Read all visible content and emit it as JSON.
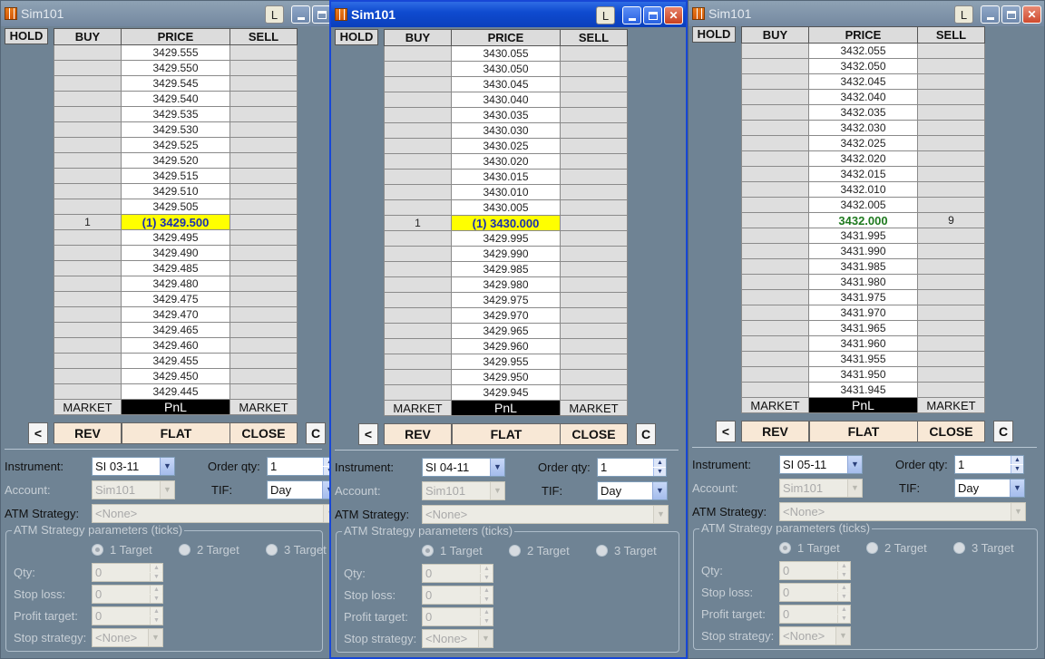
{
  "windows": [
    {
      "title": "Sim101",
      "active": false,
      "l_label": "L",
      "hold": "HOLD",
      "headers": [
        "BUY",
        "PRICE",
        "SELL"
      ],
      "rows": [
        {
          "buy": "",
          "price": "3429.555",
          "sell": ""
        },
        {
          "buy": "",
          "price": "3429.550",
          "sell": ""
        },
        {
          "buy": "",
          "price": "3429.545",
          "sell": ""
        },
        {
          "buy": "",
          "price": "3429.540",
          "sell": ""
        },
        {
          "buy": "",
          "price": "3429.535",
          "sell": ""
        },
        {
          "buy": "",
          "price": "3429.530",
          "sell": ""
        },
        {
          "buy": "",
          "price": "3429.525",
          "sell": ""
        },
        {
          "buy": "",
          "price": "3429.520",
          "sell": ""
        },
        {
          "buy": "",
          "price": "3429.515",
          "sell": ""
        },
        {
          "buy": "",
          "price": "3429.510",
          "sell": ""
        },
        {
          "buy": "",
          "price": "3429.505",
          "sell": ""
        },
        {
          "buy": "1",
          "price": "(1) 3429.500",
          "sell": "",
          "hl": "yellow"
        },
        {
          "buy": "",
          "price": "3429.495",
          "sell": ""
        },
        {
          "buy": "",
          "price": "3429.490",
          "sell": ""
        },
        {
          "buy": "",
          "price": "3429.485",
          "sell": ""
        },
        {
          "buy": "",
          "price": "3429.480",
          "sell": ""
        },
        {
          "buy": "",
          "price": "3429.475",
          "sell": ""
        },
        {
          "buy": "",
          "price": "3429.470",
          "sell": ""
        },
        {
          "buy": "",
          "price": "3429.465",
          "sell": ""
        },
        {
          "buy": "",
          "price": "3429.460",
          "sell": ""
        },
        {
          "buy": "",
          "price": "3429.455",
          "sell": ""
        },
        {
          "buy": "",
          "price": "3429.450",
          "sell": ""
        },
        {
          "buy": "",
          "price": "3429.445",
          "sell": ""
        }
      ],
      "footer": [
        "MARKET",
        "PnL",
        "MARKET"
      ],
      "actions": {
        "left": "<",
        "rev": "REV",
        "flat": "FLAT",
        "close": "CLOSE",
        "c": "C"
      },
      "form": {
        "instrument_label": "Instrument:",
        "instrument": "SI 03-11",
        "orderqty_label": "Order qty:",
        "orderqty": "1",
        "account_label": "Account:",
        "account": "Sim101",
        "tif_label": "TIF:",
        "tif": "Day",
        "atm_label": "ATM Strategy:",
        "atm": "<None>",
        "params_title": "ATM Strategy parameters (ticks)",
        "target1": "1 Target",
        "target2": "2 Target",
        "target3": "3 Target",
        "qty_label": "Qty:",
        "qty": "0",
        "stoploss_label": "Stop loss:",
        "stoploss": "0",
        "profit_label": "Profit target:",
        "profit": "0",
        "stopstrat_label": "Stop strategy:",
        "stopstrat": "<None>"
      }
    },
    {
      "title": "Sim101",
      "active": true,
      "l_label": "L",
      "hold": "HOLD",
      "headers": [
        "BUY",
        "PRICE",
        "SELL"
      ],
      "rows": [
        {
          "buy": "",
          "price": "3430.055",
          "sell": ""
        },
        {
          "buy": "",
          "price": "3430.050",
          "sell": ""
        },
        {
          "buy": "",
          "price": "3430.045",
          "sell": ""
        },
        {
          "buy": "",
          "price": "3430.040",
          "sell": ""
        },
        {
          "buy": "",
          "price": "3430.035",
          "sell": ""
        },
        {
          "buy": "",
          "price": "3430.030",
          "sell": ""
        },
        {
          "buy": "",
          "price": "3430.025",
          "sell": ""
        },
        {
          "buy": "",
          "price": "3430.020",
          "sell": ""
        },
        {
          "buy": "",
          "price": "3430.015",
          "sell": ""
        },
        {
          "buy": "",
          "price": "3430.010",
          "sell": ""
        },
        {
          "buy": "",
          "price": "3430.005",
          "sell": ""
        },
        {
          "buy": "1",
          "price": "(1) 3430.000",
          "sell": "",
          "hl": "yellow"
        },
        {
          "buy": "",
          "price": "3429.995",
          "sell": ""
        },
        {
          "buy": "",
          "price": "3429.990",
          "sell": ""
        },
        {
          "buy": "",
          "price": "3429.985",
          "sell": ""
        },
        {
          "buy": "",
          "price": "3429.980",
          "sell": ""
        },
        {
          "buy": "",
          "price": "3429.975",
          "sell": ""
        },
        {
          "buy": "",
          "price": "3429.970",
          "sell": ""
        },
        {
          "buy": "",
          "price": "3429.965",
          "sell": ""
        },
        {
          "buy": "",
          "price": "3429.960",
          "sell": ""
        },
        {
          "buy": "",
          "price": "3429.955",
          "sell": ""
        },
        {
          "buy": "",
          "price": "3429.950",
          "sell": ""
        },
        {
          "buy": "",
          "price": "3429.945",
          "sell": ""
        }
      ],
      "footer": [
        "MARKET",
        "PnL",
        "MARKET"
      ],
      "actions": {
        "left": "<",
        "rev": "REV",
        "flat": "FLAT",
        "close": "CLOSE",
        "c": "C"
      },
      "form": {
        "instrument_label": "Instrument:",
        "instrument": "SI 04-11",
        "orderqty_label": "Order qty:",
        "orderqty": "1",
        "account_label": "Account:",
        "account": "Sim101",
        "tif_label": "TIF:",
        "tif": "Day",
        "atm_label": "ATM Strategy:",
        "atm": "<None>",
        "params_title": "ATM Strategy parameters (ticks)",
        "target1": "1 Target",
        "target2": "2 Target",
        "target3": "3 Target",
        "qty_label": "Qty:",
        "qty": "0",
        "stoploss_label": "Stop loss:",
        "stoploss": "0",
        "profit_label": "Profit target:",
        "profit": "0",
        "stopstrat_label": "Stop strategy:",
        "stopstrat": "<None>"
      }
    },
    {
      "title": "Sim101",
      "active": false,
      "l_label": "L",
      "hold": "HOLD",
      "headers": [
        "BUY",
        "PRICE",
        "SELL"
      ],
      "rows": [
        {
          "buy": "",
          "price": "3432.055",
          "sell": ""
        },
        {
          "buy": "",
          "price": "3432.050",
          "sell": ""
        },
        {
          "buy": "",
          "price": "3432.045",
          "sell": ""
        },
        {
          "buy": "",
          "price": "3432.040",
          "sell": ""
        },
        {
          "buy": "",
          "price": "3432.035",
          "sell": ""
        },
        {
          "buy": "",
          "price": "3432.030",
          "sell": ""
        },
        {
          "buy": "",
          "price": "3432.025",
          "sell": ""
        },
        {
          "buy": "",
          "price": "3432.020",
          "sell": ""
        },
        {
          "buy": "",
          "price": "3432.015",
          "sell": ""
        },
        {
          "buy": "",
          "price": "3432.010",
          "sell": ""
        },
        {
          "buy": "",
          "price": "3432.005",
          "sell": ""
        },
        {
          "buy": "",
          "price": "3432.000",
          "sell": "9",
          "hl": "green"
        },
        {
          "buy": "",
          "price": "3431.995",
          "sell": ""
        },
        {
          "buy": "",
          "price": "3431.990",
          "sell": ""
        },
        {
          "buy": "",
          "price": "3431.985",
          "sell": ""
        },
        {
          "buy": "",
          "price": "3431.980",
          "sell": ""
        },
        {
          "buy": "",
          "price": "3431.975",
          "sell": ""
        },
        {
          "buy": "",
          "price": "3431.970",
          "sell": ""
        },
        {
          "buy": "",
          "price": "3431.965",
          "sell": ""
        },
        {
          "buy": "",
          "price": "3431.960",
          "sell": ""
        },
        {
          "buy": "",
          "price": "3431.955",
          "sell": ""
        },
        {
          "buy": "",
          "price": "3431.950",
          "sell": ""
        },
        {
          "buy": "",
          "price": "3431.945",
          "sell": ""
        }
      ],
      "footer": [
        "MARKET",
        "PnL",
        "MARKET"
      ],
      "actions": {
        "left": "<",
        "rev": "REV",
        "flat": "FLAT",
        "close": "CLOSE",
        "c": "C"
      },
      "form": {
        "instrument_label": "Instrument:",
        "instrument": "SI 05-11",
        "orderqty_label": "Order qty:",
        "orderqty": "1",
        "account_label": "Account:",
        "account": "Sim101",
        "tif_label": "TIF:",
        "tif": "Day",
        "atm_label": "ATM Strategy:",
        "atm": "<None>",
        "params_title": "ATM Strategy parameters (ticks)",
        "target1": "1 Target",
        "target2": "2 Target",
        "target3": "3 Target",
        "qty_label": "Qty:",
        "qty": "0",
        "stoploss_label": "Stop loss:",
        "stoploss": "0",
        "profit_label": "Profit target:",
        "profit": "0",
        "stopstrat_label": "Stop strategy:",
        "stopstrat": "<None>"
      }
    }
  ]
}
